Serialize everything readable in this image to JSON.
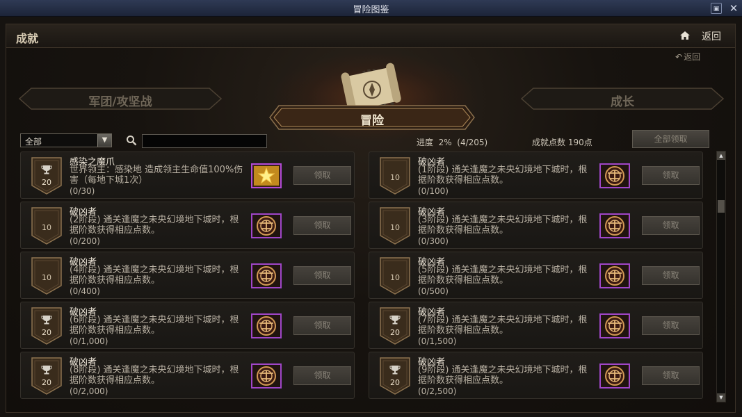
{
  "window": {
    "title": "冒险图鉴",
    "minimize_label": "▣",
    "close_label": "✕"
  },
  "header": {
    "title": "成就",
    "return_label": "返回"
  },
  "return_link": "返回",
  "tabs": {
    "left": "军团/攻坚战",
    "center": "冒险",
    "right": "成长"
  },
  "toolbar": {
    "filter_value": "全部",
    "search_placeholder": "",
    "progress_text": "进度  2%  (4/205)",
    "points_text": "成就点数 190点",
    "claim_all_label": "全部领取"
  },
  "list": {
    "claim_label": "领取",
    "items": [
      {
        "title": "感染之魔爪",
        "desc": "世界领主：感染地        造成领主生命值100%伤害（每地下城1次）",
        "progress": "(0/30)",
        "points": "20",
        "trophy": true,
        "reward": "star"
      },
      {
        "title": "破凶者",
        "desc": "(1阶段) 通关逢魔之未央幻境地下城时，根据阶数获得相应点数。",
        "progress": "(0/100)",
        "points": "10",
        "trophy": false,
        "reward": "emblem"
      },
      {
        "title": "破凶者",
        "desc": "(2阶段) 通关逢魔之未央幻境地下城时，根据阶数获得相应点数。",
        "progress": "(0/200)",
        "points": "10",
        "trophy": false,
        "reward": "emblem"
      },
      {
        "title": "破凶者",
        "desc": "(3阶段) 通关逢魔之未央幻境地下城时，根据阶数获得相应点数。",
        "progress": "(0/300)",
        "points": "10",
        "trophy": false,
        "reward": "emblem"
      },
      {
        "title": "破凶者",
        "desc": "(4阶段) 通关逢魔之未央幻境地下城时，根据阶数获得相应点数。",
        "progress": "(0/400)",
        "points": "10",
        "trophy": false,
        "reward": "emblem"
      },
      {
        "title": "破凶者",
        "desc": "(5阶段) 通关逢魔之未央幻境地下城时，根据阶数获得相应点数。",
        "progress": "(0/500)",
        "points": "10",
        "trophy": false,
        "reward": "emblem"
      },
      {
        "title": "破凶者",
        "desc": "(6阶段) 通关逢魔之未央幻境地下城时，根据阶数获得相应点数。",
        "progress": "(0/1,000)",
        "points": "20",
        "trophy": true,
        "reward": "emblem"
      },
      {
        "title": "破凶者",
        "desc": "(7阶段) 通关逢魔之未央幻境地下城时，根据阶数获得相应点数。",
        "progress": "(0/1,500)",
        "points": "20",
        "trophy": true,
        "reward": "emblem"
      },
      {
        "title": "破凶者",
        "desc": "(8阶段) 通关逢魔之未央幻境地下城时，根据阶数获得相应点数。",
        "progress": "(0/2,000)",
        "points": "20",
        "trophy": true,
        "reward": "emblem"
      },
      {
        "title": "破凶者",
        "desc": "(9阶段) 通关逢魔之未央幻境地下城时，根据阶数获得相应点数。",
        "progress": "(0/2,500)",
        "points": "20",
        "trophy": true,
        "reward": "emblem"
      }
    ]
  },
  "colors": {
    "accent": "#c8a878",
    "panel_bg": "#17130f",
    "card_border": "#34302a"
  }
}
